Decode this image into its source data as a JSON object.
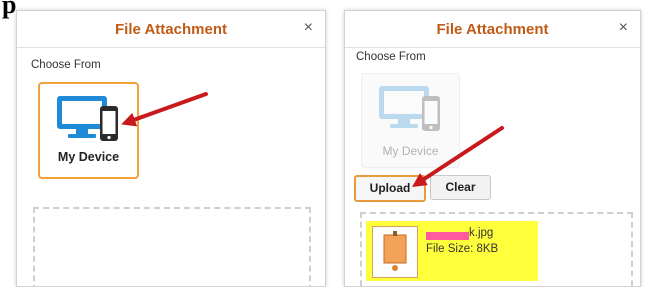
{
  "corner_text": "p",
  "left_dialog": {
    "title": "File Attachment",
    "close_glyph": "×",
    "choose_from_label": "Choose From",
    "device_tile": {
      "label": "My Device",
      "state": "selected"
    }
  },
  "right_dialog": {
    "title": "File Attachment",
    "close_glyph": "×",
    "choose_from_label": "Choose From",
    "device_tile": {
      "label": "My Device",
      "state": "disabled"
    },
    "buttons": {
      "upload": "Upload",
      "clear": "Clear"
    },
    "attachment": {
      "file_name_suffix": "k.jpg",
      "file_size": "File Size: 8KB"
    }
  },
  "colors": {
    "title": "#c05b16",
    "tile_border_selected": "#f2a23b",
    "monitor": "#1f8ad5",
    "phone": "#2b2b2b",
    "arrow": "#c8191c",
    "file_highlight": "#ffff3b",
    "redaction": "#ff5aa0"
  }
}
